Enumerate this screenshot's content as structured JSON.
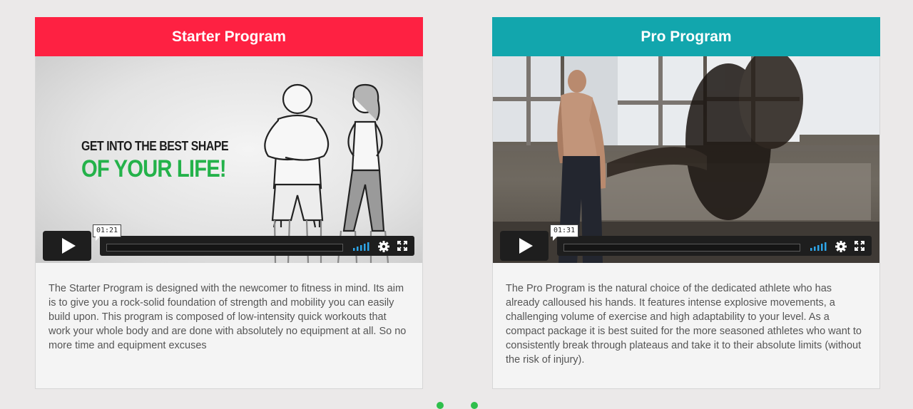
{
  "colors": {
    "starter_header": "#fe2142",
    "pro_header": "#12a6ad",
    "volume_blue": "#2ea6e9",
    "headline_green": "#24b24a"
  },
  "cards": [
    {
      "title": "Starter Program",
      "video": {
        "headline_line1": "GET INTO THE BEST SHAPE",
        "headline_line2": "OF YOUR LIFE!",
        "time": "01:21"
      },
      "description": "The Starter Program is designed with the newcomer to fitness in mind. Its aim is to give you a rock-solid foundation of strength and mobility you can easily build upon. This program is composed of low-intensity quick workouts that work your whole body and are done with absolutely no equipment at all. So no more time and equipment excuses"
    },
    {
      "title": "Pro Program",
      "video": {
        "time": "01:31"
      },
      "description": "The Pro Program is the natural choice of the dedicated athlete who has already calloused his hands. It features intense explosive movements, a challenging volume of exercise and high adaptability to your level. As a compact package it is best suited for the more seasoned athletes who want to consistently break through plateaus and take it to their absolute limits (without the risk of injury)."
    }
  ],
  "icons": {
    "play": "play-icon",
    "volume": "volume-icon",
    "settings": "gear-icon",
    "fullscreen": "fullscreen-icon"
  }
}
